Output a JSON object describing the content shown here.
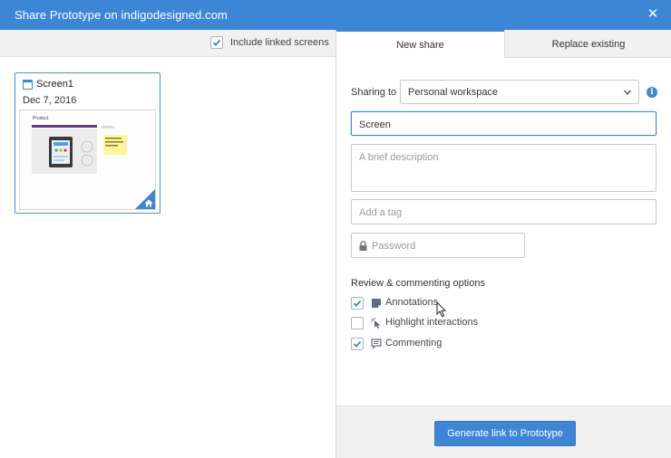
{
  "window": {
    "title": "Share Prototype on indigodesigned.com",
    "close_glyph": "✕"
  },
  "left_toolbar": {
    "include_linked_label": "Include linked screens",
    "include_linked_checked": true
  },
  "screen_card": {
    "name": "Screen1",
    "date": "Dec 7, 2016",
    "thumbnail_title": "Product",
    "icon": "document-icon",
    "badge_icon": "home-icon"
  },
  "tabs": [
    {
      "label": "New share",
      "active": true
    },
    {
      "label": "Replace existing",
      "active": false
    }
  ],
  "form": {
    "sharing_to_label": "Sharing to",
    "sharing_to_value": "Personal workspace",
    "info_glyph": "i",
    "name_value": "Screen",
    "description_placeholder": "A brief description",
    "tag_placeholder": "Add a tag",
    "password_placeholder": "Password"
  },
  "review": {
    "title": "Review & commenting options",
    "options": [
      {
        "label": "Annotations",
        "checked": true,
        "icon": "annotation-icon"
      },
      {
        "label": "Highlight interactions",
        "checked": false,
        "icon": "cursor-click-icon"
      },
      {
        "label": "Commenting",
        "checked": true,
        "icon": "comment-icon"
      }
    ]
  },
  "footer": {
    "generate_label": "Generate link to Prototype"
  },
  "colors": {
    "accent": "#3d86d6",
    "panel_bg": "#f1f1f1"
  }
}
